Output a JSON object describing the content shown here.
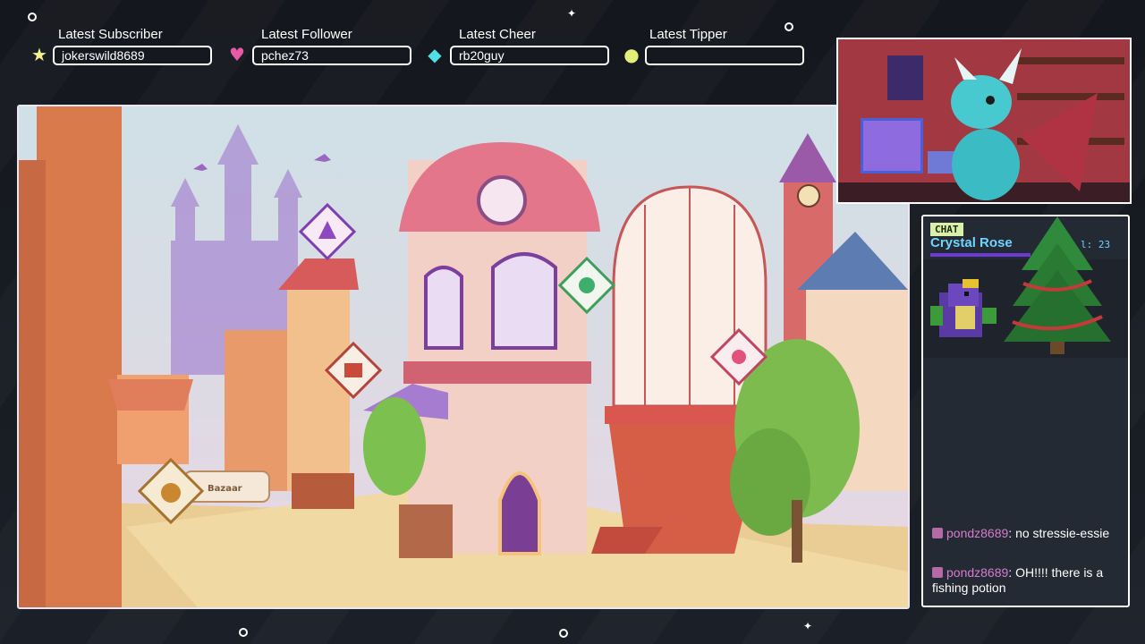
{
  "stats": [
    {
      "label": "Latest Subscriber",
      "value": "jokerswild8689",
      "icon": "star-icon",
      "color": "#f3f08e"
    },
    {
      "label": "Latest Follower",
      "value": "pchez73",
      "icon": "heart-icon",
      "color": "#e85aa8"
    },
    {
      "label": "Latest Cheer",
      "value": "rb20guy",
      "icon": "gem-icon",
      "color": "#4fe0e6"
    },
    {
      "label": "Latest Tipper",
      "value": "",
      "icon": "coin-icon",
      "color": "#e3ef78"
    }
  ],
  "game": {
    "bazaar_label": "Bazaar"
  },
  "chat": {
    "tag": "CHAT",
    "latest_name": "Crystal Rose",
    "level_text": "l: 23",
    "messages": [
      {
        "user": "pondz8689",
        "text": "no stressie-essie"
      },
      {
        "user": "pondz8689",
        "text": "OH!!!! there is a fishing potion"
      }
    ]
  }
}
